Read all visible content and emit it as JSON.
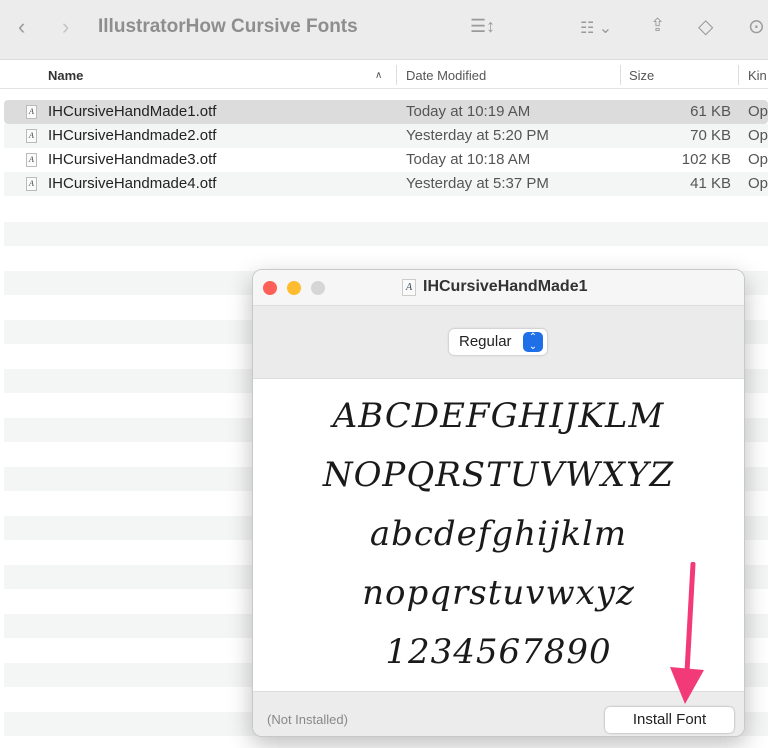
{
  "toolbar": {
    "title": "IllustratorHow Cursive Fonts"
  },
  "columns": {
    "name": "Name",
    "date": "Date Modified",
    "size": "Size",
    "kind": "Kin"
  },
  "files": [
    {
      "name": "IHCursiveHandMade1.otf",
      "date": "Today at 10:19 AM",
      "size": "61 KB",
      "kind": "Op"
    },
    {
      "name": "IHCursiveHandmade2.otf",
      "date": "Yesterday at 5:20 PM",
      "size": "70 KB",
      "kind": "Op"
    },
    {
      "name": "IHCursiveHandmade3.otf",
      "date": "Today at 10:18 AM",
      "size": "102 KB",
      "kind": "Op"
    },
    {
      "name": "IHCursiveHandmade4.otf",
      "date": "Yesterday at 5:37 PM",
      "size": "41 KB",
      "kind": "Op"
    }
  ],
  "dialog": {
    "title": "IHCursiveHandMade1",
    "style": "Regular",
    "sample": [
      "ABCDEFGHIJKLM",
      "NOPQRSTUVWXYZ",
      "abcdefghijklm",
      "nopqrstuvwxyz",
      "1234567890"
    ],
    "status": "(Not Installed)",
    "install_label": "Install Font"
  },
  "colors": {
    "arrow": "#f23a78",
    "accent": "#1f6fe8"
  }
}
